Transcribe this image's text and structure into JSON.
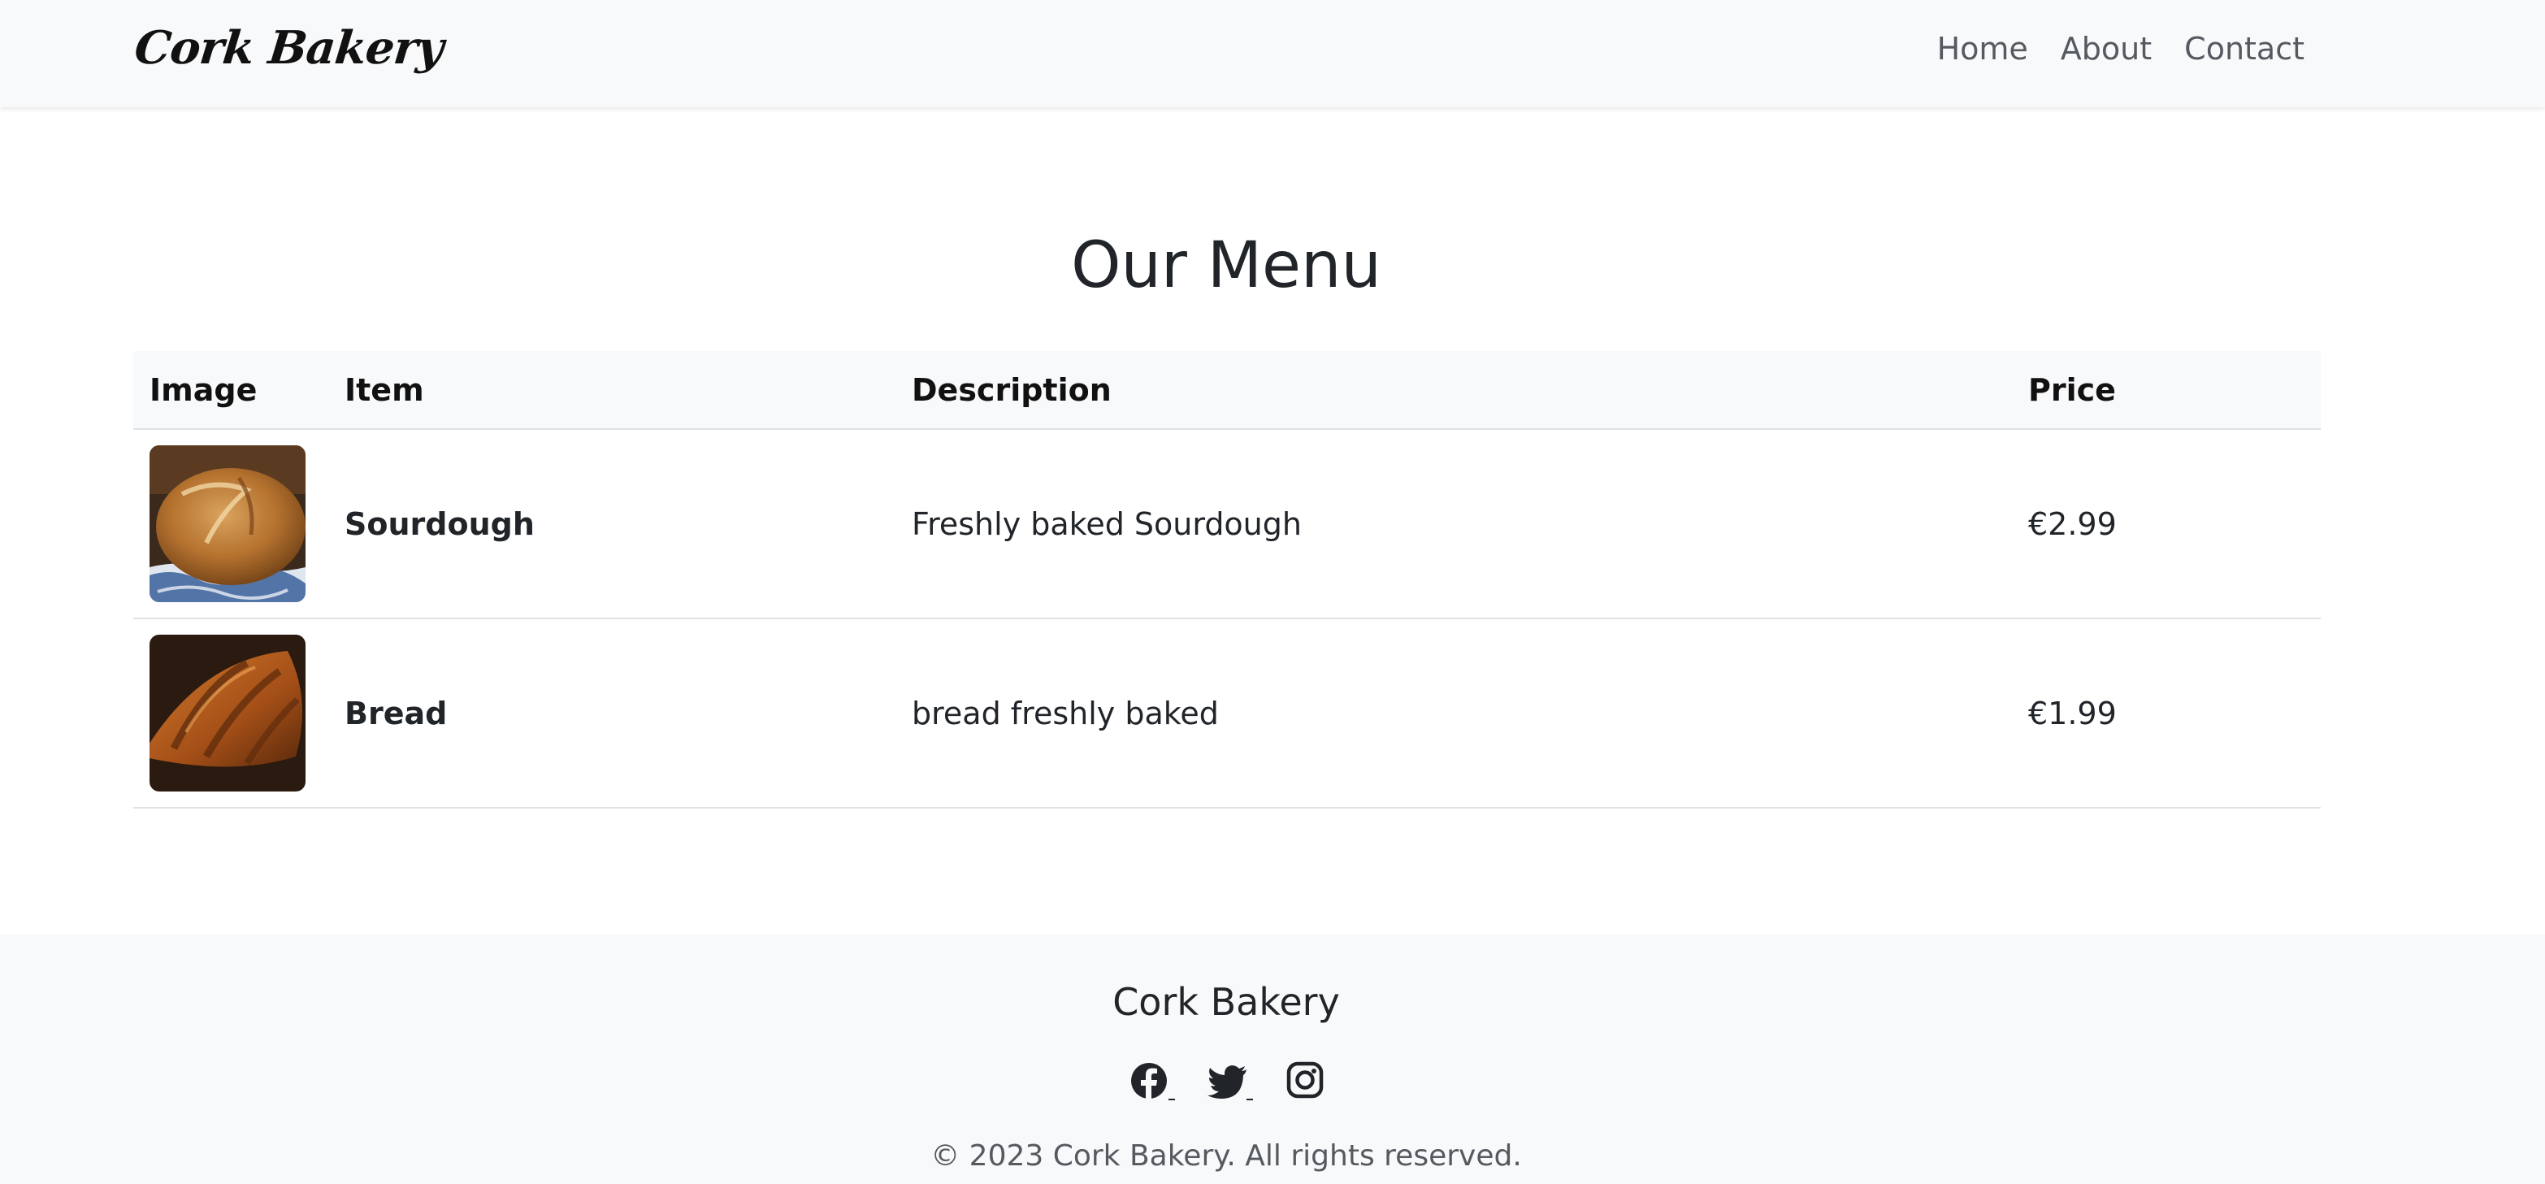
{
  "navbar": {
    "brand": "Cork Bakery",
    "links": [
      {
        "label": "Home"
      },
      {
        "label": "About"
      },
      {
        "label": "Contact"
      }
    ]
  },
  "main": {
    "title": "Our Menu",
    "table": {
      "headers": [
        "Image",
        "Item",
        "Description",
        "Price"
      ],
      "rows": [
        {
          "image_icon": "sourdough-image",
          "item": "Sourdough",
          "description": "Freshly baked Sourdough",
          "price": "€2.99"
        },
        {
          "image_icon": "croissant-image",
          "item": "Bread",
          "description": "bread freshly baked",
          "price": "€1.99"
        }
      ]
    }
  },
  "footer": {
    "title": "Cork Bakery",
    "socials": [
      {
        "icon": "facebook-icon"
      },
      {
        "icon": "twitter-icon"
      },
      {
        "icon": "instagram-icon"
      }
    ],
    "copyright": "© 2023 Cork Bakery. All rights reserved."
  },
  "colors": {
    "navbar_bg": "#f8f9fa",
    "text": "#212529",
    "muted_text": "#555a60",
    "border": "#dee2e6"
  }
}
